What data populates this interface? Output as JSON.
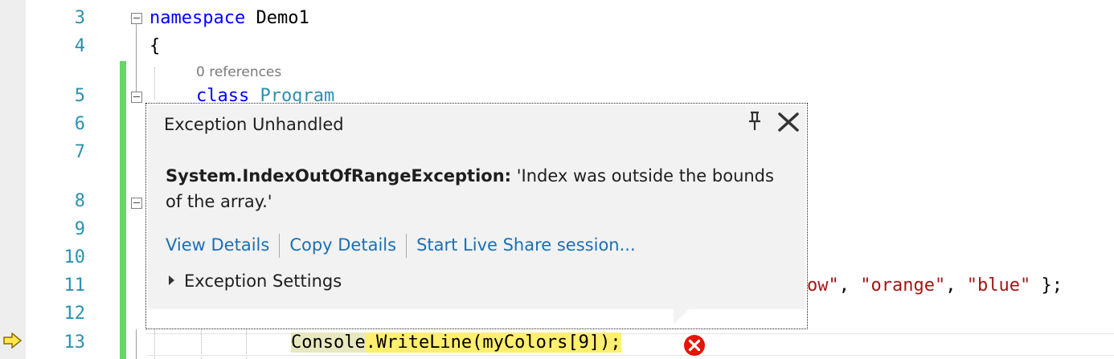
{
  "editor": {
    "line_numbers": [
      "3",
      "4",
      "5",
      "6",
      "7",
      "8",
      "9",
      "10",
      "11",
      "12",
      "13"
    ],
    "code": {
      "line3_keyword": "namespace",
      "line3_name": " Demo1",
      "line4": "{",
      "codelens_refs": "0 references",
      "line5_keyword": "class",
      "line5_type": "Program",
      "line11_str_partial": "ow\"",
      "line11_sep1": ", ",
      "line11_str2": "\"orange\"",
      "line11_sep2": ", ",
      "line11_str3": "\"blue\"",
      "line11_end": " };",
      "line13_class": "Console",
      "line13_rest": ".WriteLine(myColors[9]);"
    },
    "colors": {
      "keyword": "#0000ff",
      "type": "#2b91af",
      "string": "#a31515",
      "highlight": "#ffef6e",
      "change_bar": "#6bd36b"
    }
  },
  "popup": {
    "title": "Exception Unhandled",
    "pin_icon": "pin-icon",
    "close_icon": "close-icon",
    "exception_type": "System.IndexOutOfRangeException:",
    "exception_message": " 'Index was outside the bounds of the array.'",
    "links": {
      "view_details": "View Details",
      "copy_details": "Copy Details",
      "live_share": "Start Live Share session..."
    },
    "settings_label": "Exception Settings"
  }
}
